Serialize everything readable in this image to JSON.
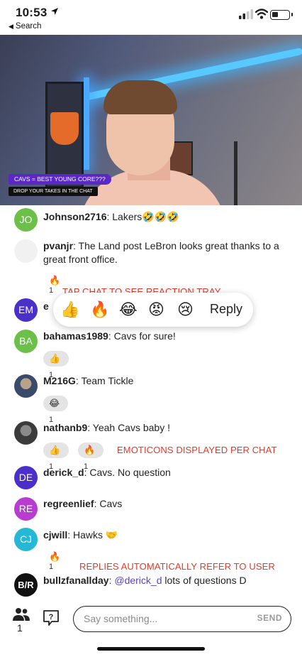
{
  "status_bar": {
    "time": "10:53",
    "back_label": "Search"
  },
  "video": {
    "caption_top": "CAVS = BEST YOUNG CORE???",
    "caption_bottom": "DROP YOUR TAKES IN THE CHAT"
  },
  "chat": [
    {
      "avatar": "JO",
      "avatar_color": "#6cc04a",
      "user": "Johnson2716",
      "text": "Lakers🤣🤣🤣"
    },
    {
      "avatar": "",
      "user": "pvanjr",
      "text": "The Land post LeBron looks great thanks to a great front office.",
      "reaction": {
        "emoji": "🔥",
        "count": "1"
      }
    },
    {
      "avatar": "EM",
      "avatar_color": "#4a2fc8",
      "user": "e"
    },
    {
      "avatar": "BA",
      "avatar_color": "#6cc04a",
      "user": "bahamas1989",
      "text": "Cavs for sure!",
      "reaction": {
        "emoji": "👍",
        "count": "1"
      }
    },
    {
      "avatar": "",
      "user": "M216G",
      "text": "Team Tickle",
      "reaction": {
        "emoji": "😂",
        "count": "1"
      }
    },
    {
      "avatar": "",
      "user": "nathanb9",
      "text": "Yeah Cavs baby !",
      "reactions": [
        {
          "emoji": "👍",
          "count": "1"
        },
        {
          "emoji": "🔥",
          "count": "1"
        }
      ]
    },
    {
      "avatar": "DE",
      "avatar_color": "#4a2fc8",
      "user": "derick_d",
      "text": "Cavs. No question"
    },
    {
      "avatar": "RE",
      "avatar_color": "#b83cd0",
      "user": "regreenlief",
      "text": "Cavs"
    },
    {
      "avatar": "CJ",
      "avatar_color": "#25b8d6",
      "user": "cjwill",
      "text": "Hawks 🤝",
      "reaction": {
        "emoji": "🔥",
        "count": "1"
      }
    },
    {
      "avatar": "B/R",
      "user": "bullzfanallday",
      "mention": "@derick_d",
      "text": "lots of questions D"
    }
  ],
  "reaction_tray": {
    "emojis": [
      "👍",
      "🔥",
      "😂",
      "😡",
      "😢"
    ],
    "reply_label": "Reply"
  },
  "annotations": {
    "tap_chat": "TAP CHAT TO SEE REACTION TRAY",
    "emoticons": "EMOTICONS DISPLAYED PER CHAT",
    "replies": "REPLIES AUTOMATICALLY REFER TO USER"
  },
  "bottom_bar": {
    "viewer_count": "1",
    "input_placeholder": "Say something...",
    "send_label": "SEND"
  },
  "icons": {
    "viewers": "people-icon",
    "help": "question-chat-icon",
    "location": "location-arrow-icon"
  }
}
